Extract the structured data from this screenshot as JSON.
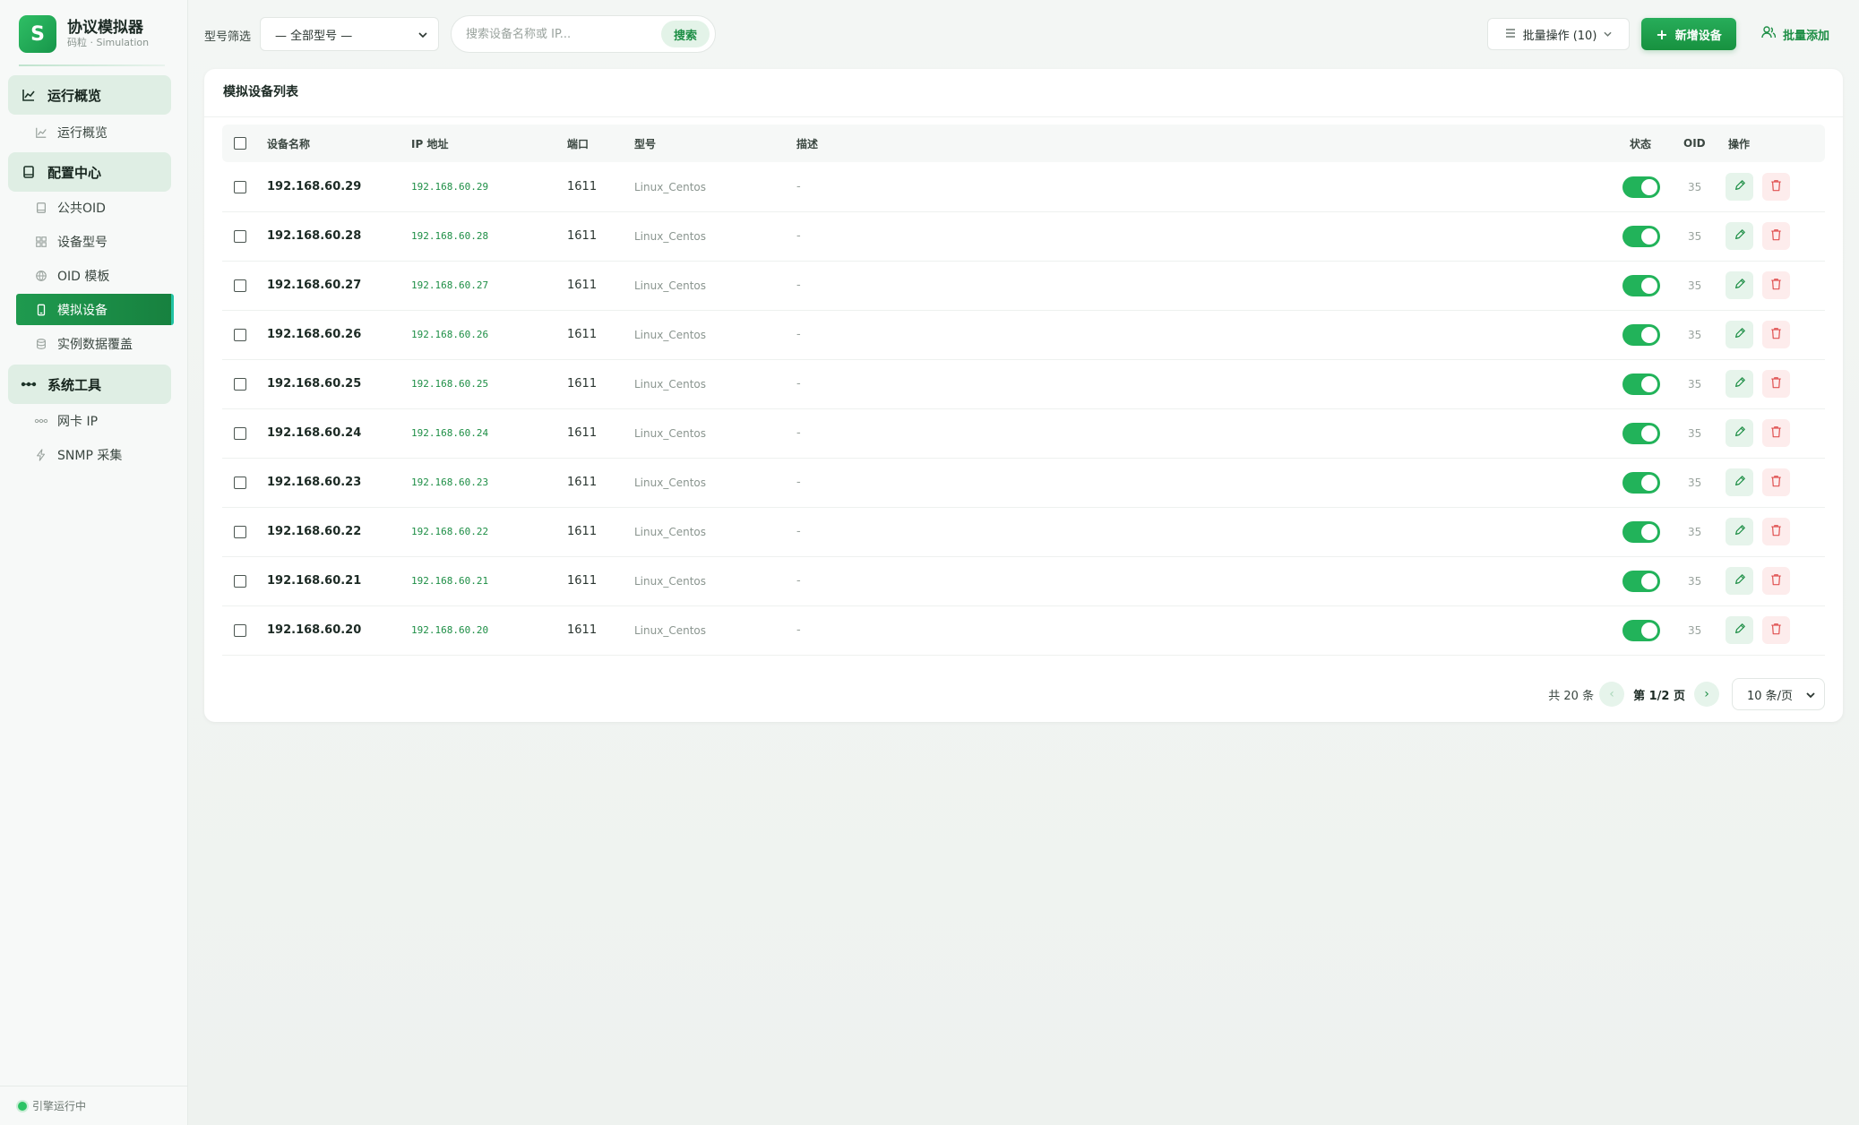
{
  "brand": {
    "logo": "S",
    "title": "协议模拟器",
    "subtitle": "码粒 · Simulation"
  },
  "sidebar": {
    "groups": [
      {
        "label": "运行概览",
        "icon": "chart-line-icon",
        "items": [
          {
            "label": "运行概览",
            "icon": "chart-line-icon"
          }
        ]
      },
      {
        "label": "配置中心",
        "icon": "book-icon",
        "items": [
          {
            "label": "公共OID",
            "icon": "book-icon"
          },
          {
            "label": "设备型号",
            "icon": "grid-icon"
          },
          {
            "label": "OID 模板",
            "icon": "globe-icon"
          },
          {
            "label": "模拟设备",
            "icon": "device-icon",
            "active": true
          },
          {
            "label": "实例数据覆盖",
            "icon": "database-icon"
          }
        ]
      },
      {
        "label": "系统工具",
        "icon": "network-icon",
        "items": [
          {
            "label": "网卡 IP",
            "icon": "network-icon"
          },
          {
            "label": "SNMP 采集",
            "icon": "bolt-icon"
          }
        ]
      }
    ],
    "footer_status": "引擎运行中"
  },
  "topbar": {
    "filter_label": "型号筛选",
    "model_select_value": "— 全部型号 —",
    "search_placeholder": "搜索设备名称或 IP...",
    "search_button": "搜索",
    "batch_button": "批量操作 (10)",
    "add_button": "新增设备",
    "bulk_add_button": "批量添加"
  },
  "card": {
    "title": "模拟设备列表",
    "columns": {
      "name": "设备名称",
      "ip": "IP 地址",
      "port": "端口",
      "model": "型号",
      "desc": "描述",
      "status": "状态",
      "oid": "OID",
      "actions": "操作"
    },
    "rows": [
      {
        "name": "192.168.60.29",
        "ip": "192.168.60.29",
        "port": "1611",
        "model": "Linux_Centos",
        "desc": "-",
        "enabled": true,
        "oid": "35"
      },
      {
        "name": "192.168.60.28",
        "ip": "192.168.60.28",
        "port": "1611",
        "model": "Linux_Centos",
        "desc": "-",
        "enabled": true,
        "oid": "35"
      },
      {
        "name": "192.168.60.27",
        "ip": "192.168.60.27",
        "port": "1611",
        "model": "Linux_Centos",
        "desc": "-",
        "enabled": true,
        "oid": "35"
      },
      {
        "name": "192.168.60.26",
        "ip": "192.168.60.26",
        "port": "1611",
        "model": "Linux_Centos",
        "desc": "-",
        "enabled": true,
        "oid": "35"
      },
      {
        "name": "192.168.60.25",
        "ip": "192.168.60.25",
        "port": "1611",
        "model": "Linux_Centos",
        "desc": "-",
        "enabled": true,
        "oid": "35"
      },
      {
        "name": "192.168.60.24",
        "ip": "192.168.60.24",
        "port": "1611",
        "model": "Linux_Centos",
        "desc": "-",
        "enabled": true,
        "oid": "35"
      },
      {
        "name": "192.168.60.23",
        "ip": "192.168.60.23",
        "port": "1611",
        "model": "Linux_Centos",
        "desc": "-",
        "enabled": true,
        "oid": "35"
      },
      {
        "name": "192.168.60.22",
        "ip": "192.168.60.22",
        "port": "1611",
        "model": "Linux_Centos",
        "desc": "-",
        "enabled": true,
        "oid": "35"
      },
      {
        "name": "192.168.60.21",
        "ip": "192.168.60.21",
        "port": "1611",
        "model": "Linux_Centos",
        "desc": "-",
        "enabled": true,
        "oid": "35"
      },
      {
        "name": "192.168.60.20",
        "ip": "192.168.60.20",
        "port": "1611",
        "model": "Linux_Centos",
        "desc": "-",
        "enabled": true,
        "oid": "35"
      }
    ],
    "pagination": {
      "total": "共 20 条",
      "page": "第 1/2 页",
      "page_size": "10 条/页",
      "prev_icon": "chevron-left-icon",
      "next_icon": "chevron-right-icon"
    }
  },
  "colors": {
    "accent": "#1d8e45",
    "accent_light": "#e3f3e8",
    "danger": "#e05252",
    "toggle_on": "#22b35a"
  }
}
